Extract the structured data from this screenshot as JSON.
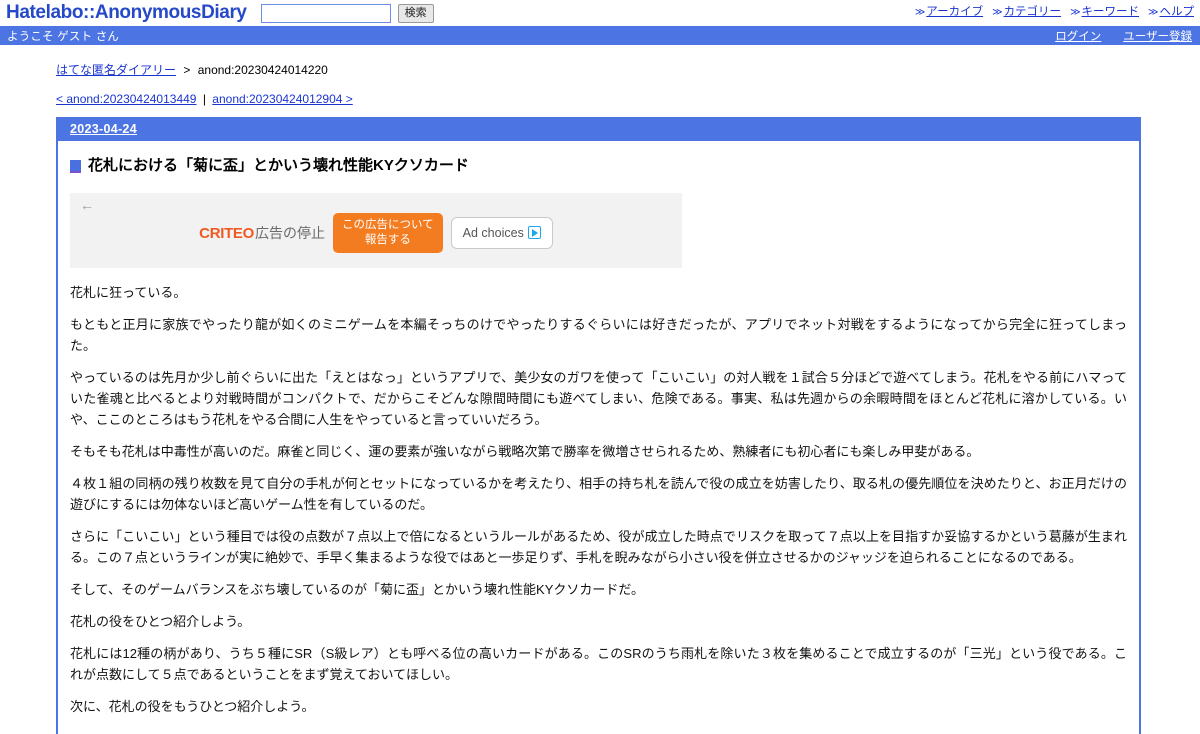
{
  "header": {
    "site_title": "Hatelabo::AnonymousDiary",
    "search": {
      "value": "",
      "placeholder": "",
      "button_label": "検索"
    },
    "nav_marker": "≫",
    "nav_links": [
      {
        "label": "アーカイブ"
      },
      {
        "label": "カテゴリー"
      },
      {
        "label": "キーワード"
      },
      {
        "label": "ヘルプ"
      }
    ]
  },
  "user_bar": {
    "greeting": "ようこそ ゲスト さん",
    "links": [
      {
        "label": "ログイン"
      },
      {
        "label": "ユーザー登録"
      }
    ]
  },
  "breadcrumb": {
    "home_label": "はてな匿名ダイアリー",
    "separator": ">",
    "current": "anond:20230424014220"
  },
  "paging": {
    "prev_label": "< anond:20230424013449",
    "divider": "|",
    "next_label": "anond:20230424012904 >"
  },
  "article": {
    "date": "2023-04-24",
    "title": "花札における「菊に盃」とかいう壊れ性能KYクソカード",
    "title_icon": "blue-square-icon"
  },
  "ad": {
    "back_arrow": "←",
    "brand_first": "C",
    "brand_flip": "Я",
    "brand_rest": "ITEO",
    "brand_text": "広告の停止",
    "report_line1": "この広告について",
    "report_line2": "報告する",
    "adchoices_label": "Ad choices"
  },
  "content": {
    "paragraphs": [
      "花札に狂っている。",
      "もともと正月に家族でやったり龍が如くのミニゲームを本編そっちのけでやったりするぐらいには好きだったが、アプリでネット対戦をするようになってから完全に狂ってしまった。",
      "やっているのは先月か少し前ぐらいに出た「えとはなっ」というアプリで、美少女のガワを使って「こいこい」の対人戦を１試合５分ほどで遊べてしまう。花札をやる前にハマっていた雀魂と比べるとより対戦時間がコンパクトで、だからこそどんな隙間時間にも遊べてしまい、危険である。事実、私は先週からの余暇時間をほとんど花札に溶かしている。いや、ここのところはもう花札をやる合間に人生をやっていると言っていいだろう。",
      "そもそも花札は中毒性が高いのだ。麻雀と同じく、運の要素が強いながら戦略次第で勝率を微増させられるため、熟練者にも初心者にも楽しみ甲斐がある。",
      "４枚１組の同柄の残り枚数を見て自分の手札が何とセットになっているかを考えたり、相手の持ち札を読んで役の成立を妨害したり、取る札の優先順位を決めたりと、お正月だけの遊びにするには勿体ないほど高いゲーム性を有しているのだ。",
      "さらに「こいこい」という種目では役の点数が７点以上で倍になるというルールがあるため、役が成立した時点でリスクを取って７点以上を目指すか妥協するかという葛藤が生まれる。この７点というラインが実に絶妙で、手早く集まるような役ではあと一歩足りず、手札を睨みながら小さい役を併立させるかのジャッジを迫られることになるのである。",
      "そして、そのゲームバランスをぶち壊しているのが「菊に盃」とかいう壊れ性能KYクソカードだ。",
      "花札の役をひとつ紹介しよう。",
      "花札には12種の柄があり、うち５種にSR（S級レア）とも呼べる位の高いカードがある。このSRのうち雨札を除いた３枚を集めることで成立するのが「三光」という役である。これが点数にして５点であるということをまず覚えておいてほしい。",
      "次に、花札の役をもうひとつ紹介しよう。"
    ]
  },
  "colors": {
    "brand_blue": "#4d74e3",
    "link_blue": "#1a34d0",
    "title_blue": "#2549c8",
    "ad_orange": "#f47c20",
    "criteo_orange": "#f05a22"
  }
}
